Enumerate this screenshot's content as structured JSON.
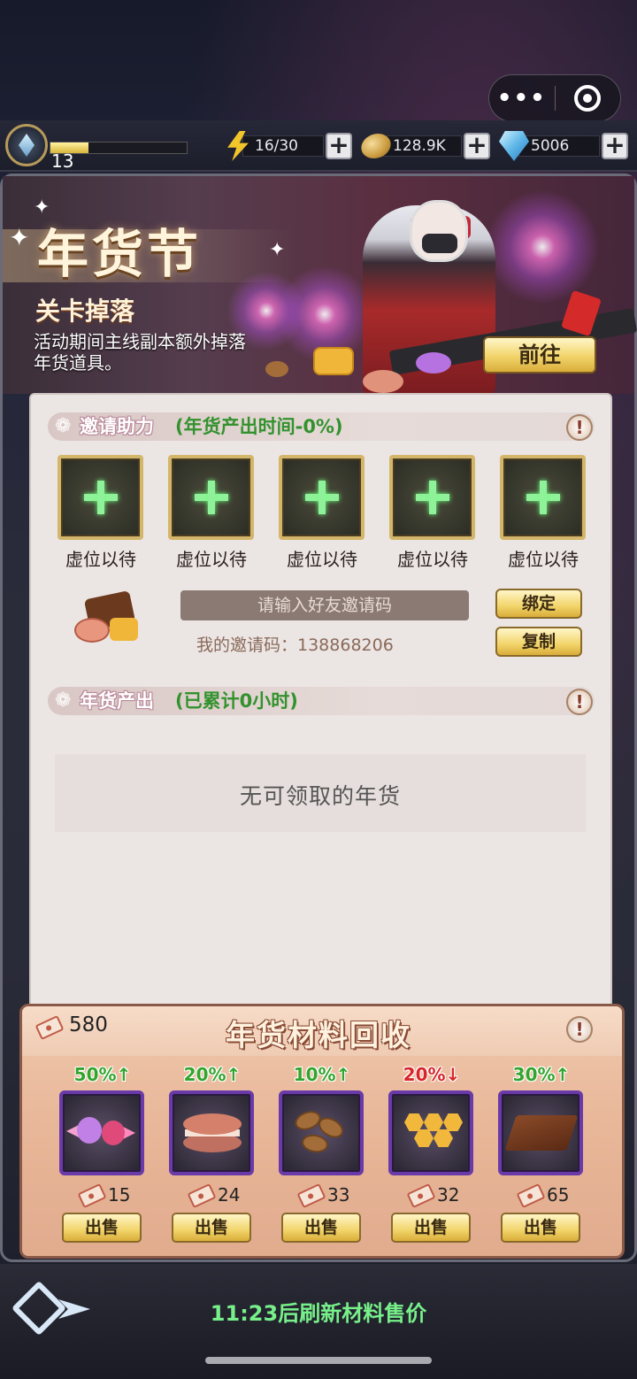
{
  "capsule": {
    "more_icon": "more-dots-icon",
    "close_icon": "target-icon"
  },
  "status": {
    "level": "13",
    "xp_fraction": 0.28,
    "energy": "16/30",
    "coins": "128.9K",
    "gems": "5006"
  },
  "banner": {
    "title": "年货节",
    "subtitle": "关卡掉落",
    "description": "活动期间主线副本额外掉落年货道具。",
    "goto_label": "前往"
  },
  "invite": {
    "header": "邀请助力",
    "note": "(年货产出时间-0%)",
    "slots": [
      "虚位以待",
      "虚位以待",
      "虚位以待",
      "虚位以待",
      "虚位以待"
    ],
    "input_placeholder": "请输入好友邀请码",
    "my_code": "我的邀请码：138868206",
    "bind_label": "绑定",
    "copy_label": "复制"
  },
  "output": {
    "header": "年货产出",
    "note": "(已累计0小时)",
    "empty_text": "无可领取的年货"
  },
  "recycle": {
    "title": "年货材料回收",
    "balance": "580",
    "items": [
      {
        "name": "candy",
        "pct": "50%↑",
        "trend": "up",
        "price": "15",
        "sell": "出售"
      },
      {
        "name": "macaron",
        "pct": "20%↑",
        "trend": "up",
        "price": "24",
        "sell": "出售"
      },
      {
        "name": "nuts",
        "pct": "10%↑",
        "trend": "up",
        "price": "33",
        "sell": "出售"
      },
      {
        "name": "honeycomb",
        "pct": "20%↓",
        "trend": "down",
        "price": "32",
        "sell": "出售"
      },
      {
        "name": "chocolate",
        "pct": "30%↑",
        "trend": "up",
        "price": "65",
        "sell": "出售"
      }
    ]
  },
  "footer": {
    "refresh_text": "11:23后刷新材料售价"
  },
  "colors": {
    "up": "#33a52e",
    "down": "#d8262a",
    "accent_gold": "#f2d46a",
    "item_border": "#6a3aa8"
  }
}
